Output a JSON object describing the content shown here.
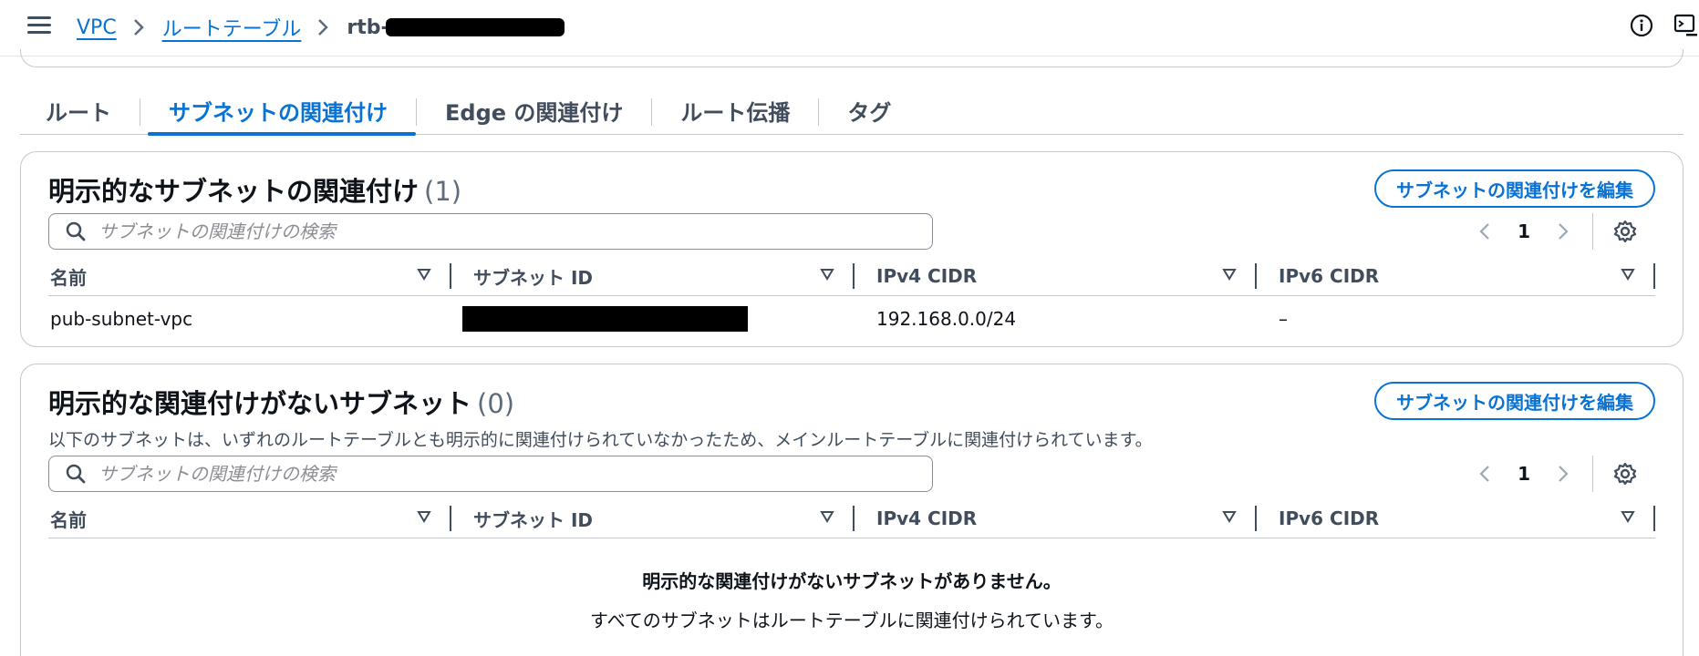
{
  "breadcrumb": {
    "items": [
      "VPC",
      "ルートテーブル"
    ],
    "current_prefix": "rtb-"
  },
  "icons": {
    "menu": "hamburger-menu-icon",
    "info": "info-icon",
    "console": "console-icon",
    "search": "search-icon",
    "settings": "gear-icon",
    "sort": "sort-caret-icon"
  },
  "colors": {
    "accent": "#0972d3",
    "text": "#0f141a",
    "muted": "#414d5c",
    "border": "#c6c6cd"
  },
  "tabs": [
    {
      "label": "ルート",
      "active": false
    },
    {
      "label": "サブネットの関連付け",
      "active": true
    },
    {
      "label": "Edge の関連付け",
      "active": false
    },
    {
      "label": "ルート伝播",
      "active": false
    },
    {
      "label": "タグ",
      "active": false
    }
  ],
  "explicit": {
    "title": "明示的なサブネットの関連付け",
    "count": "(1)",
    "edit_label": "サブネットの関連付けを編集",
    "search_placeholder": "サブネットの関連付けの検索",
    "page": "1",
    "columns": [
      "名前",
      "サブネット ID",
      "IPv4 CIDR",
      "IPv6 CIDR"
    ],
    "rows": [
      {
        "name": "pub-subnet-vpc",
        "subnet_id": "",
        "ipv4": "192.168.0.0/24",
        "ipv6": "–"
      }
    ]
  },
  "implicit": {
    "title": "明示的な関連付けがないサブネット",
    "count": "(0)",
    "edit_label": "サブネットの関連付けを編集",
    "description": "以下のサブネットは、いずれのルートテーブルとも明示的に関連付けられていなかったため、メインルートテーブルに関連付けられています。",
    "search_placeholder": "サブネットの関連付けの検索",
    "page": "1",
    "columns": [
      "名前",
      "サブネット ID",
      "IPv4 CIDR",
      "IPv6 CIDR"
    ],
    "empty_title": "明示的な関連付けがないサブネットがありません。",
    "empty_desc": "すべてのサブネットはルートテーブルに関連付けられています。"
  }
}
